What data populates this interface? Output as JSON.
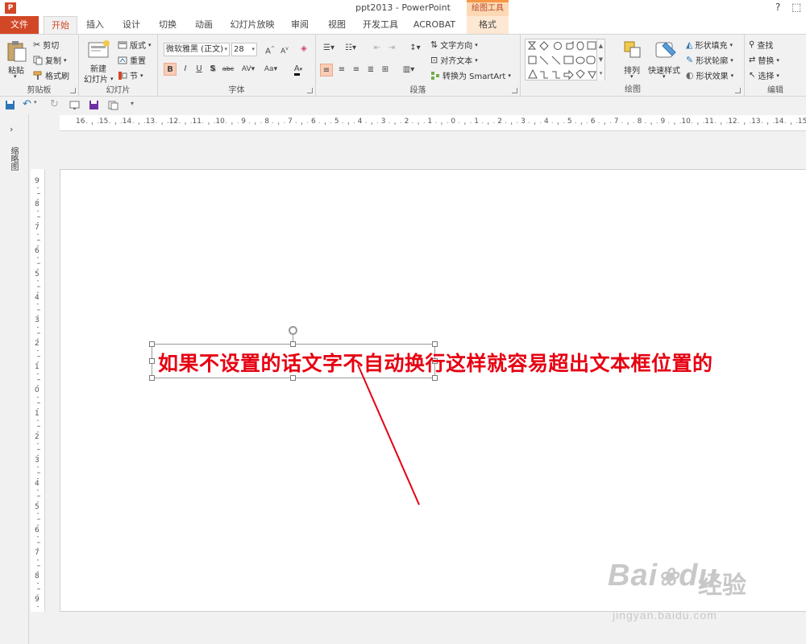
{
  "window": {
    "title": "ppt2013 - PowerPoint",
    "help": "?",
    "contextual_header": "绘图工具",
    "app_icon": "P"
  },
  "tabs": {
    "file": "文件",
    "home": "开始",
    "insert": "插入",
    "design": "设计",
    "transitions": "切换",
    "animations": "动画",
    "slideshow": "幻灯片放映",
    "review": "审阅",
    "view": "视图",
    "developer": "开发工具",
    "acrobat": "ACROBAT",
    "format": "格式"
  },
  "ribbon": {
    "clipboard": {
      "label": "剪贴板",
      "paste": "粘贴",
      "cut": "剪切",
      "copy": "复制",
      "format_painter": "格式刷"
    },
    "slides": {
      "label": "幻灯片",
      "new_slide_1": "新建",
      "new_slide_2": "幻灯片",
      "layout": "版式",
      "reset": "重置",
      "section": "节"
    },
    "font": {
      "label": "字体",
      "font_name": "微软雅黑 (正文)",
      "font_size": "28"
    },
    "paragraph": {
      "label": "段落",
      "text_direction": "文字方向",
      "align_text": "对齐文本",
      "smartart": "转换为 SmartArt"
    },
    "drawing": {
      "label": "绘图",
      "arrange": "排列",
      "quick_styles": "快速样式",
      "shape_fill": "形状填充",
      "shape_outline": "形状轮廓",
      "shape_effects": "形状效果"
    },
    "editing": {
      "label": "编辑",
      "find": "查找",
      "replace": "替换",
      "select": "选择"
    }
  },
  "left_pane": {
    "label": "缩略图"
  },
  "rulers": {
    "horizontal": [
      "16",
      "15",
      "14",
      "13",
      "12",
      "11",
      "10",
      "9",
      "8",
      "7",
      "6",
      "5",
      "4",
      "3",
      "2",
      "1",
      "0",
      "1",
      "2",
      "3",
      "4",
      "5",
      "6",
      "7",
      "8",
      "9",
      "10",
      "11",
      "12",
      "13",
      "14",
      "15"
    ],
    "vertical": [
      "9",
      "8",
      "7",
      "6",
      "5",
      "4",
      "3",
      "2",
      "1",
      "0",
      "1",
      "2",
      "3",
      "4",
      "5",
      "6",
      "7",
      "8",
      "9"
    ]
  },
  "slide": {
    "text": "如果不设置的话文字不自动换行这样就容易超出文本框位置的"
  },
  "watermark": {
    "brand": "Bai",
    "brand2": "du",
    "cn": "经验",
    "url": "jingyan.baidu.com"
  },
  "colors": {
    "accent": "#d24726",
    "slide_text": "#e60012",
    "arrow": "#e60012"
  }
}
